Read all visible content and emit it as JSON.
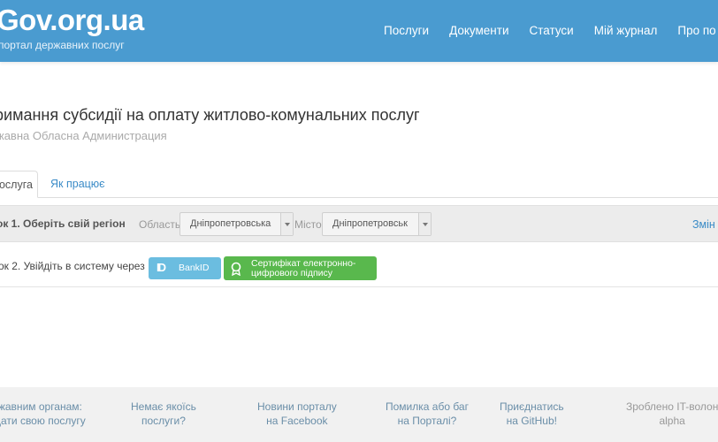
{
  "header": {
    "logo": "Gov.org.ua",
    "logo_sub": "портал державних послуг",
    "nav": [
      "Послуги",
      "Документи",
      "Статуси",
      "Мій журнал",
      "Про по"
    ]
  },
  "service": {
    "title": "римання субсидії на оплату житлово-комунальних послуг",
    "org": "жавна Обласна Администрация"
  },
  "tabs": {
    "service": "Послуга",
    "how_it_works": "Як працює"
  },
  "step1": {
    "label": "ок 1. Оберіть свій регіон",
    "region_label": "Область",
    "region_value": "Дніпропетровська",
    "city_label": "Місто",
    "city_value": "Дніпропетровськ",
    "change_link": "Змін"
  },
  "step2": {
    "label": "ок 2. Увійдіть в систему через",
    "bankid_label": "BankID",
    "cert_label_line1": "Сертифікат електронно-",
    "cert_label_line2": "цифрового підпису"
  },
  "footer": {
    "items": [
      {
        "line1": "жавним органам:",
        "line2": "дати свою послугу"
      },
      {
        "line1": "Немає якоїсь",
        "line2": "послуги?"
      },
      {
        "line1": "Новини порталу",
        "line2": "на Facebook"
      },
      {
        "line1": "Помилка або баг",
        "line2": "на Порталі?"
      },
      {
        "line1": "Приєднатись",
        "line2": "на GitHub!"
      },
      {
        "line1": "Зроблено IT-волон",
        "line2": "alpha"
      }
    ]
  },
  "colors": {
    "header_bg": "#4a9bd0",
    "link": "#3a8bc7",
    "bankid": "#6bbde0",
    "cert": "#59b84d"
  }
}
